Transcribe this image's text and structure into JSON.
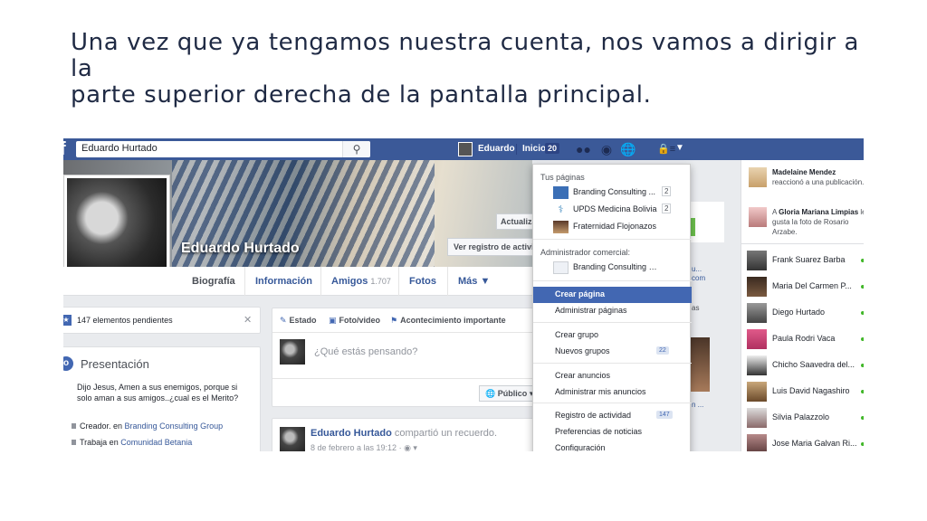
{
  "slide": {
    "title_line1": "Una vez que ya tengamos nuestra cuenta, nos vamos a dirigir a la",
    "title_line2": "parte superior derecha de la pantalla principal."
  },
  "topbar": {
    "search_value": "Eduardo Hurtado",
    "user_name": "Eduardo",
    "home_label": "Inicio",
    "home_count": "20"
  },
  "cover": {
    "name": "Eduardo Hurtado",
    "update_button": "Actualiza",
    "activity_log_button": "Ver registro de actividad"
  },
  "profile_nav": {
    "items": [
      {
        "label": "Biografía"
      },
      {
        "label": "Información"
      },
      {
        "label": "Amigos",
        "count": "1.707"
      },
      {
        "label": "Fotos"
      },
      {
        "label": "Más ▼"
      }
    ]
  },
  "left": {
    "pending": "147 elementos pendientes",
    "intro_title": "Presentación",
    "bio": "Dijo Jesus, Amen a sus enemigos, porque si solo aman a sus amigos..¿cual es el Merito?",
    "creator_prefix": "Creador. en",
    "creator_link": "Branding Consulting Group",
    "work_prefix": "Trabaja en",
    "work_link": "Comunidad Betania"
  },
  "composer": {
    "tab_status": "Estado",
    "tab_photo": "Foto/video",
    "tab_event": "Acontecimiento importante",
    "placeholder": "¿Qué estás pensando?",
    "audience": "Público ▾"
  },
  "post": {
    "author": "Eduardo Hurtado",
    "action": "compartió un recuerdo.",
    "meta": "8 de febrero a las 19:12 · ◉ ▾"
  },
  "dropdown": {
    "your_pages_header": "Tus páginas",
    "pages": [
      {
        "label": "Branding Consulting ...",
        "count": "2"
      },
      {
        "label": "UPDS Medicina Bolivia",
        "count": "2"
      },
      {
        "label": "Fraternidad Flojonazos",
        "count": ""
      }
    ],
    "business_header": "Administrador comercial:",
    "business_page": "Branding Consulting GR...",
    "items": [
      {
        "label": "Crear página",
        "count": ""
      },
      {
        "label": "Administrar páginas",
        "count": ""
      },
      {
        "label": "Crear grupo",
        "count": ""
      },
      {
        "label": "Nuevos grupos",
        "count": "22"
      },
      {
        "label": "Crear anuncios",
        "count": ""
      },
      {
        "label": "Administrar mis anuncios",
        "count": ""
      },
      {
        "label": "Registro de actividad",
        "count": "147"
      },
      {
        "label": "Preferencias de noticias",
        "count": ""
      },
      {
        "label": "Configuración",
        "count": ""
      }
    ]
  },
  "side_fragments": {
    "frag1": "u...",
    "frag2": "com",
    "frag3": "as",
    "frag4": "n ..."
  },
  "ticker": {
    "notif1_name": "Madelaine Mendez",
    "notif1_text": "reaccionó a una publicación.",
    "notif2_prefix": "A",
    "notif2_name": "Gloria Mariana Limpias",
    "notif2_text": "le gusta la foto de Rosario Arzabe.",
    "friends": [
      {
        "name": "Frank Suarez Barba"
      },
      {
        "name": "Maria Del Carmen P..."
      },
      {
        "name": "Diego Hurtado"
      },
      {
        "name": "Paula Rodri Vaca"
      },
      {
        "name": "Chicho Saavedra del..."
      },
      {
        "name": "Luis David Nagashiro"
      },
      {
        "name": "Silvia Palazzolo"
      },
      {
        "name": "Jose Maria Galvan Ri..."
      }
    ]
  },
  "colors": {
    "fb_blue": "#3b5998",
    "highlight": "#4267b2",
    "link": "#365899"
  }
}
